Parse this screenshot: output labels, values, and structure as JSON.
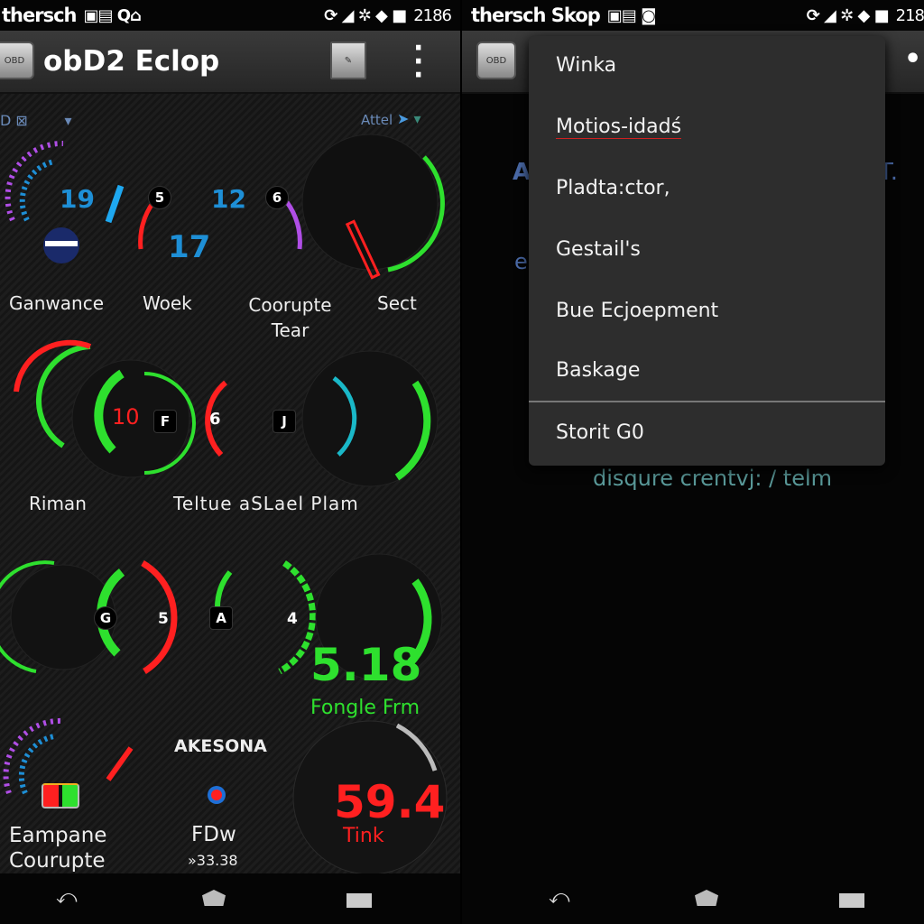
{
  "left_screen": {
    "status_bar": {
      "carrier": "thersch",
      "time": "2186"
    },
    "app_bar": {
      "title": "obD2 Eclop"
    },
    "filter_bar": {
      "right_label": "Attel"
    },
    "row1": {
      "labels": [
        "Ganwance",
        "Woek",
        "Coorupte Tear",
        "Sect"
      ],
      "values": [
        "19",
        "5",
        "12",
        "6",
        "17"
      ]
    },
    "row2": {
      "labels": [
        "Riman",
        "Teltue aSLael Plam"
      ],
      "values": [
        "10",
        "6"
      ]
    },
    "row3": {
      "values": [
        "5",
        "4"
      ],
      "readout": "5.18",
      "readout_label": "Fongle Frm"
    },
    "row4": {
      "title": "AKESONA",
      "label1": "Eampane Courupte",
      "label2": "FDw",
      "value2": "»33.38",
      "readout": "59.4",
      "readout_label": "Tink"
    }
  },
  "right_screen": {
    "status_bar": {
      "carrier": "thersch Skop",
      "time": "218"
    },
    "menu": {
      "items": [
        "Winka",
        "Motios-idadś",
        "Pladta:ctor,",
        "Gestail's",
        "Bue Ecjoepment",
        "Baskage",
        "Storit G0"
      ]
    },
    "background_text": {
      "left": "A",
      "right": "T.",
      "left2": "e",
      "bottom": "disqure crentvj: / telm"
    }
  },
  "colors": {
    "green": "#2ee02e",
    "red": "#ff2020",
    "blue": "#1e8fd6",
    "purple": "#b04ee6",
    "teal": "#5a9a9a"
  }
}
